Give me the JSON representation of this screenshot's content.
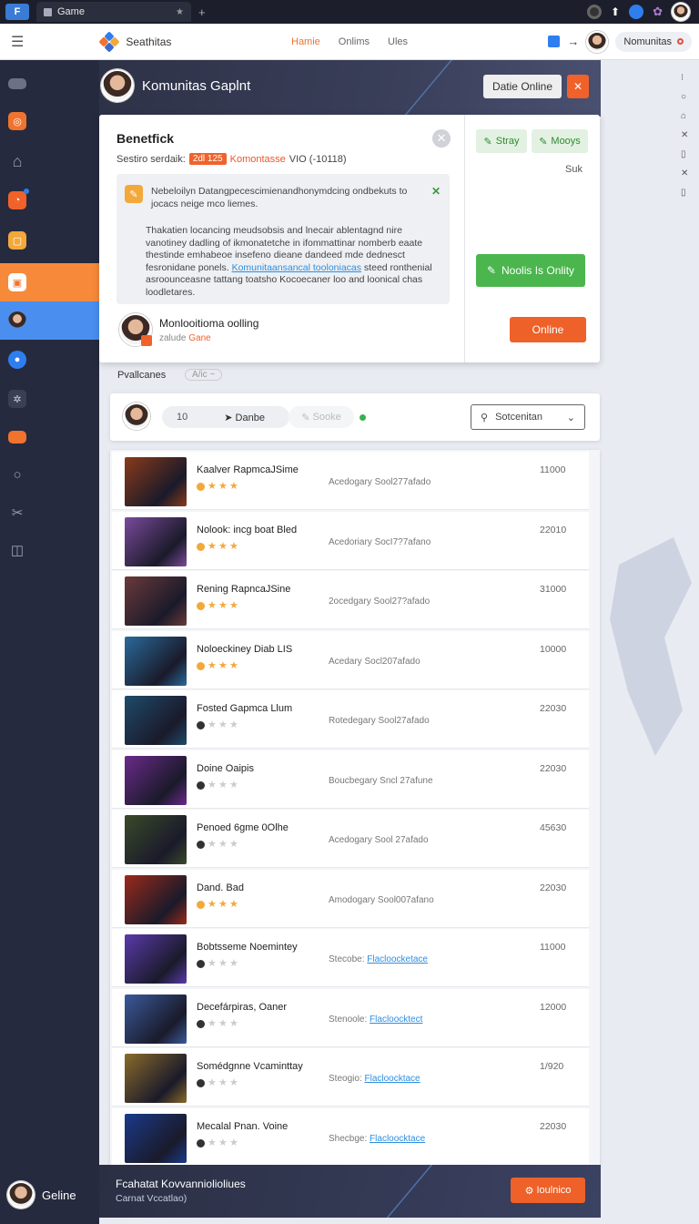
{
  "browser": {
    "tab_title": "Game",
    "logo_letter": "F",
    "newtab": "+",
    "pin": "★"
  },
  "appbar": {
    "brand": "Seathitas",
    "nav": [
      "Hamie",
      "Onlims",
      "Ules"
    ],
    "active_nav": 0,
    "arrow": "→",
    "user_pill": "Nomunitas"
  },
  "sidebar": {
    "items": [
      {
        "icon": "menu-icon",
        "color": "#9aa0b4",
        "glyph": "▬"
      },
      {
        "icon": "compass-icon",
        "color": "#f0732e",
        "glyph": "◎"
      },
      {
        "icon": "home-icon",
        "color": "transparent",
        "glyph": "⌂"
      },
      {
        "icon": "feed-icon",
        "color": "#f0622a",
        "glyph": "◔"
      },
      {
        "icon": "box-icon",
        "color": "#f3a83a",
        "glyph": "▢"
      },
      {
        "icon": "game-icon",
        "color": "#ffffff",
        "glyph": "▣"
      },
      {
        "icon": "avatar-icon",
        "color": "transparent",
        "glyph": "●"
      },
      {
        "icon": "location-icon",
        "color": "#2f7ef0",
        "glyph": "●"
      },
      {
        "icon": "puzzle-icon",
        "color": "transparent",
        "glyph": "✲"
      },
      {
        "icon": "folder-icon",
        "color": "#f0732e",
        "glyph": "▬"
      },
      {
        "icon": "search-icon",
        "color": "transparent",
        "glyph": "○"
      },
      {
        "icon": "tools-icon",
        "color": "transparent",
        "glyph": "✂"
      },
      {
        "icon": "chart-icon",
        "color": "transparent",
        "glyph": "◫"
      }
    ],
    "footer_label": "Geline"
  },
  "banner": {
    "title": "Komunitas Gaplnt",
    "button": "Datie Online",
    "close": "✕"
  },
  "card": {
    "title": "Benetfick",
    "subtitle_prefix": "Sestiro serdaik:",
    "subtitle_tag": "2dl 125",
    "subtitle_orange": "Komontasse",
    "subtitle_rest": "VIO (-10118)",
    "message_top": "Nebeloilyn Datangpecescimienandhonymdcing ondbekuts to jocacs neige mco liemes.",
    "message_body_1": "Thakatien locancing meudsobsis and lnecair ablentagnd nire vanotiney dadling of ikmonatetche in ifommattinar nomberb eaate thestinde emhabeoe insefeno dieane dandeed mde dednesct fesronidane ponels. ",
    "message_link": "Komunitaansancal tooloniacas",
    "message_body_2": " steed ronthenial asroounceasne tattang toatsho Kocoecaner loo and loonical chas loodletares.",
    "user_name": "Monlooitioma oolling",
    "user_sub_prefix": "zalude",
    "user_sub_orange": "Gane",
    "btn_stay": "Stray",
    "btn_moops": "Mooys",
    "suk": "Suk",
    "btn_green": "Noolis Is Onlity",
    "btn_online": "Online"
  },
  "panel": {
    "label": "Pvallcanes",
    "hint": "A/ic ~",
    "toolbar_num": "10",
    "toolbar_action": "Danbe",
    "toolbar_ghost": "Sooke",
    "select_value": "Sotcenitan"
  },
  "games": [
    {
      "name": "Kaalver RapmcaJSime",
      "desc": "Acedogary Sool277afado",
      "num": "11000",
      "stars": 3,
      "rated": true,
      "link": false,
      "hue": "#8a3a1a"
    },
    {
      "name": "Nolook: incg boat Bled",
      "desc": "Acedoriary SocI7?7afano",
      "num": "22010",
      "stars": 3,
      "rated": true,
      "link": false,
      "hue": "#7a4a9a"
    },
    {
      "name": "Rening RapncaJSine",
      "desc": "2ocedgary Sool27?afado",
      "num": "31000",
      "stars": 3,
      "rated": true,
      "link": false,
      "hue": "#6a3a3a"
    },
    {
      "name": "Noloeckiney Diab LIS",
      "desc": "Acedary Socl207afado",
      "num": "10000",
      "stars": 3,
      "rated": true,
      "link": false,
      "hue": "#2a6a9a"
    },
    {
      "name": "Fosted Gapmca Llum",
      "desc": "Rotedegary Sool27afado",
      "num": "22030",
      "stars": 0,
      "rated": false,
      "link": false,
      "hue": "#1f4a6a"
    },
    {
      "name": "Doine Oaipis",
      "desc": "Boucbegary Sncl 27afune",
      "num": "22030",
      "stars": 0,
      "rated": false,
      "link": false,
      "hue": "#6a2a8a"
    },
    {
      "name": "Penoed 6gme 0Olhe",
      "desc": "Acedogary Sool 27afado",
      "num": "45630",
      "stars": 0,
      "rated": false,
      "link": false,
      "hue": "#3a4a2a"
    },
    {
      "name": "Dand. Bad",
      "desc": "Amodogary Sool007afano",
      "num": "22030",
      "stars": 3,
      "rated": true,
      "link": false,
      "hue": "#9a2a1a"
    },
    {
      "name": "Bobtsseme Noemintey",
      "desc": "Stecobe:",
      "linktext": "Flacloocketace",
      "num": "11000",
      "stars": 0,
      "rated": false,
      "link": true,
      "hue": "#5a3aaa"
    },
    {
      "name": "Decefárpiras, Oaner",
      "desc": "Stenoole:",
      "linktext": "Flacloocktect",
      "num": "12000",
      "stars": 0,
      "rated": false,
      "link": true,
      "hue": "#3a5a9a"
    },
    {
      "name": "Somédgnne Vcaminttay",
      "desc": "Steogio:",
      "linktext": "Flacloocktace",
      "num": "1/920",
      "stars": 0,
      "rated": false,
      "link": true,
      "hue": "#8a6a2a"
    },
    {
      "name": "Mecalal Pnan. Voine",
      "desc": "Shecbge:",
      "linktext": "Flacloocktace",
      "num": "22030",
      "stars": 0,
      "rated": false,
      "link": true,
      "hue": "#1a3a8a"
    }
  ],
  "footer": {
    "title": "Fcahatat Kovvanniolioliues",
    "sub": "Carnat Vccatlao)",
    "button": "Ioulnico"
  },
  "rightrail": [
    "⁝",
    "○",
    "⌂",
    "✕",
    "▯",
    "✕",
    "▯"
  ]
}
